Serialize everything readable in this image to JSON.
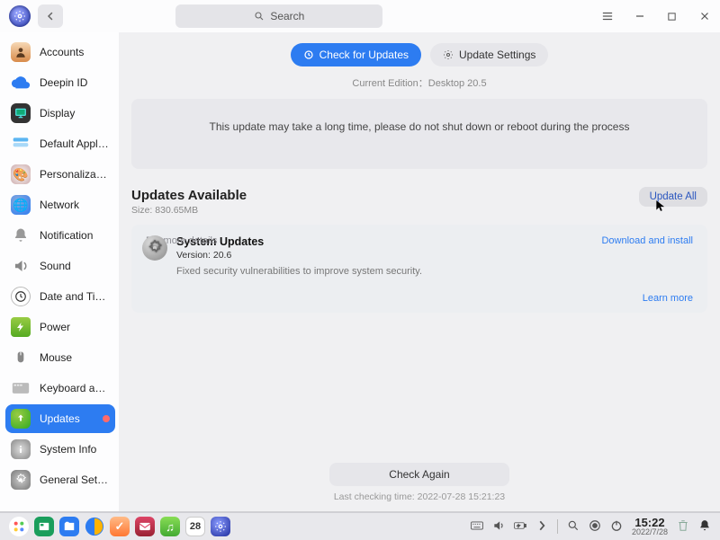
{
  "window": {
    "search_placeholder": "Search"
  },
  "sidebar": {
    "items": [
      {
        "label": "Accounts"
      },
      {
        "label": "Deepin ID"
      },
      {
        "label": "Display"
      },
      {
        "label": "Default Applica..."
      },
      {
        "label": "Personalization"
      },
      {
        "label": "Network"
      },
      {
        "label": "Notification"
      },
      {
        "label": "Sound"
      },
      {
        "label": "Date and Time"
      },
      {
        "label": "Power"
      },
      {
        "label": "Mouse"
      },
      {
        "label": "Keyboard and ..."
      },
      {
        "label": "Updates"
      },
      {
        "label": "System Info"
      },
      {
        "label": "General Settings"
      }
    ]
  },
  "main": {
    "check_updates": "Check for Updates",
    "update_settings": "Update Settings",
    "edition_prefix": "Current Edition：",
    "edition_value": "Desktop 20.5",
    "warning": "This update may take a long time, please do not shut down or reboot during the process",
    "avail_title": "Updates Available",
    "avail_size": "Size: 830.65MB",
    "update_all": "Update All",
    "card": {
      "detail_hint": "For more details",
      "title": "System Updates",
      "version": "Version: 20.6",
      "desc": "Fixed security vulnerabilities to improve system security.",
      "download": "Download and install",
      "learn": "Learn more"
    },
    "check_again": "Check Again",
    "last_check_prefix": "Last checking time: ",
    "last_check_value": "2022-07-28 15:21:23"
  },
  "taskbar": {
    "calendar_day": "28",
    "time": "15:22",
    "date": "2022/7/28"
  }
}
